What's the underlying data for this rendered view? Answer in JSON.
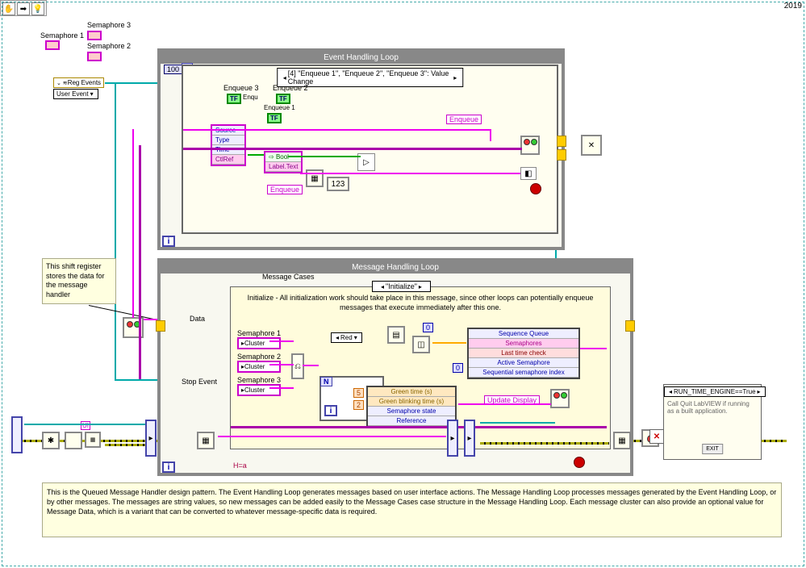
{
  "toolbar": {
    "year": "2019"
  },
  "terminals": {
    "s1": "Semaphore 1",
    "s2": "Semaphore 2",
    "s3": "Semaphore 3"
  },
  "event_loop": {
    "title": "Event Handling Loop",
    "timeout": "100",
    "case": "[4] \"Enqueue 1\", \"Enqueue 2\", \"Enqueue 3\": Value Change",
    "enq1": "Enqueue 1",
    "enq2": "Enqueue 2",
    "enq3": "Enqueue 3",
    "tf": "TF",
    "unbundle": [
      "Source",
      "Type",
      "Time",
      "CtlRef"
    ],
    "prop_bool": "Bool",
    "prop_label": "Label.Text",
    "enqueue": "Enqueue",
    "i": "i"
  },
  "reg": {
    "reg_events": "Reg Events",
    "user_event": "User Event"
  },
  "shift_note": "This shift register stores the data for the message handler",
  "msg_loop": {
    "title": "Message Handling Loop",
    "cases_label": "Message Cases",
    "case": "\"Initialize\"",
    "comment": "Initialize - All initialization work should take place in this message, since other loops can potentially enqueue messages that execute immediately after this one.",
    "data_label": "Data",
    "stop_label": "Stop Event",
    "sem1": "Semaphore 1",
    "sem2": "Semaphore 2",
    "sem3": "Semaphore 3",
    "cluster": "Cluster",
    "red_ring": "Red",
    "bundle": [
      "Sequence Queue",
      "Semaphores",
      "Last time check",
      "Active Semaphore",
      "Sequential semaphore index"
    ],
    "col2": [
      "Green time (s)",
      "Green blinking time (s)",
      "Semaphore state",
      "Reference"
    ],
    "n": "N",
    "i": "i",
    "const5": "5",
    "const2": "2",
    "const0_a": "0",
    "const0_b": "0",
    "update_display": "Update Display",
    "ha": "H=a",
    "ui": "UI"
  },
  "runtime": {
    "selector": "RUN_TIME_ENGINE==True",
    "text": "Call Quit LabVIEW if running as a built application.",
    "exit": "EXIT"
  },
  "description": "This is the Queued Message Handler design pattern. The Event Handling Loop generates messages based on user interface actions. The Message Handling Loop processes messages generated by the Event Handling Loop, or by other messages.  The messages are string values, so new messages can be added easily to the Message Cases case structure in the Message Handling Loop.  Each message cluster can also provide an optional value for Message Data, which is a variant that can be converted to whatever message-specific data is required."
}
